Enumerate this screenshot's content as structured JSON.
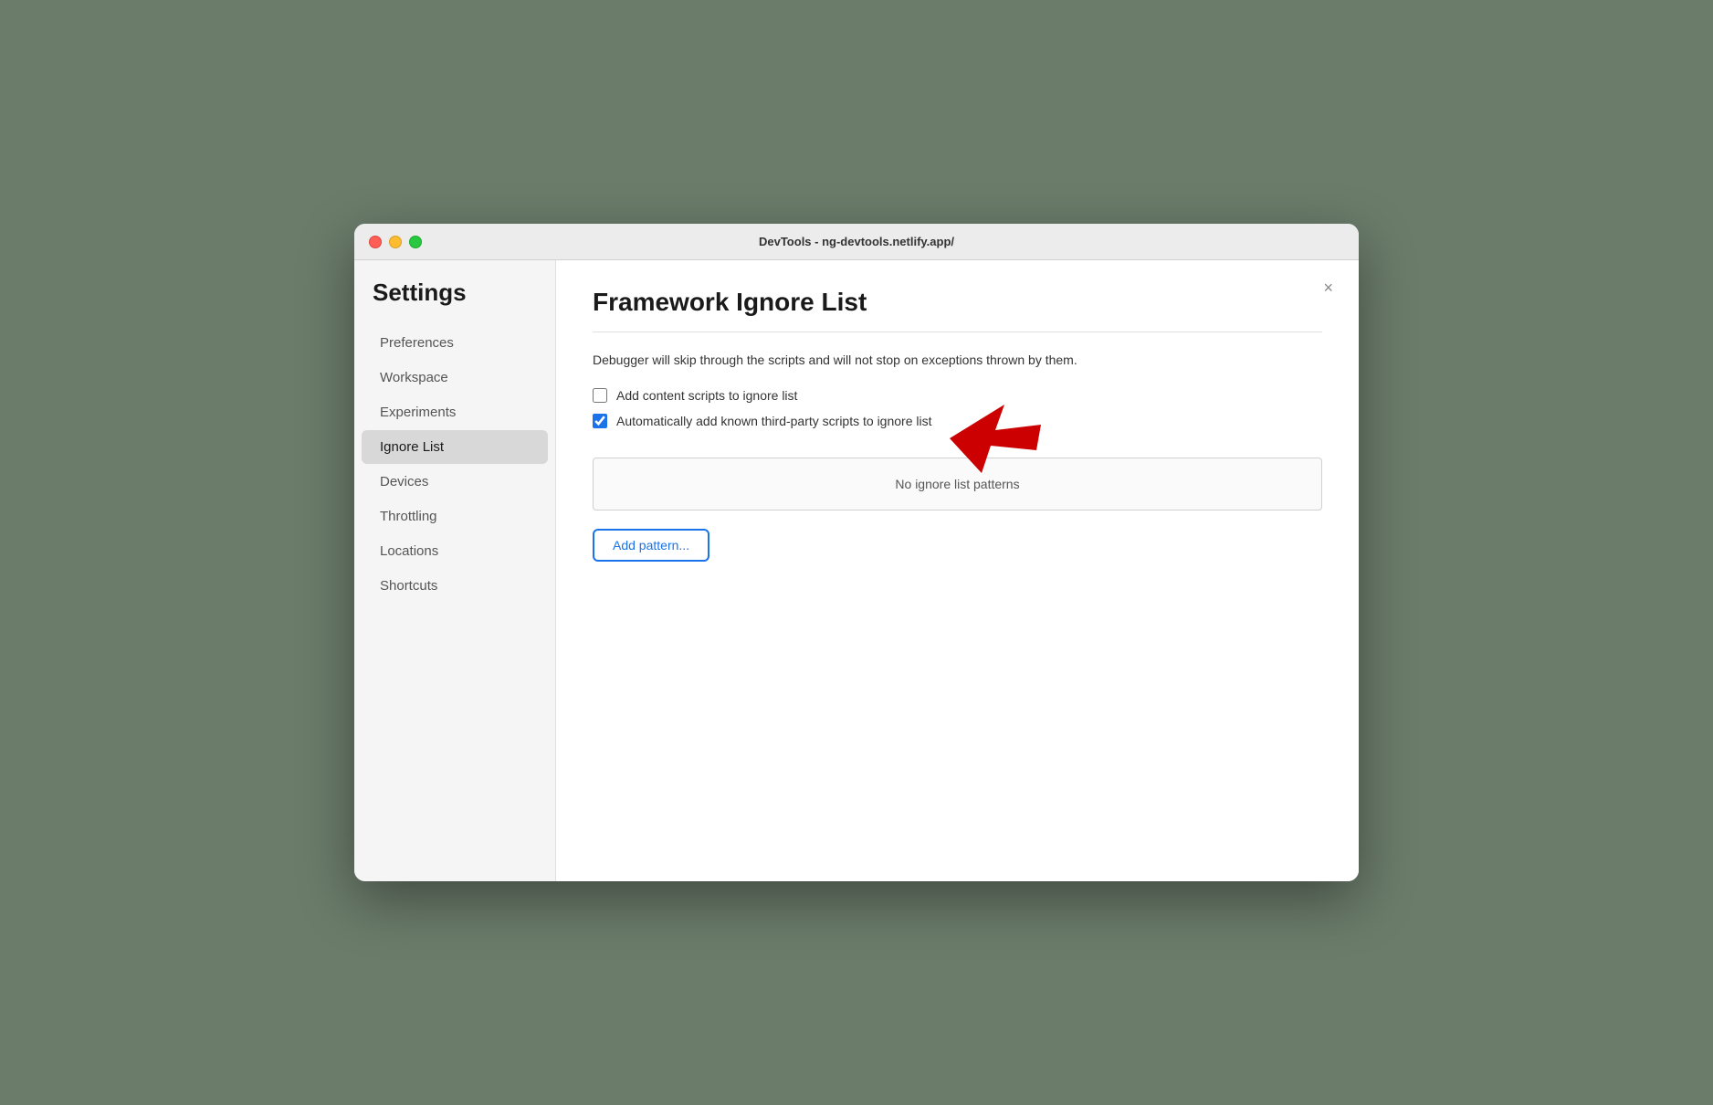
{
  "window": {
    "title": "DevTools - ng-devtools.netlify.app/"
  },
  "sidebar": {
    "heading": "Settings",
    "items": [
      {
        "id": "preferences",
        "label": "Preferences",
        "active": false
      },
      {
        "id": "workspace",
        "label": "Workspace",
        "active": false
      },
      {
        "id": "experiments",
        "label": "Experiments",
        "active": false
      },
      {
        "id": "ignore-list",
        "label": "Ignore List",
        "active": true
      },
      {
        "id": "devices",
        "label": "Devices",
        "active": false
      },
      {
        "id": "throttling",
        "label": "Throttling",
        "active": false
      },
      {
        "id": "locations",
        "label": "Locations",
        "active": false
      },
      {
        "id": "shortcuts",
        "label": "Shortcuts",
        "active": false
      }
    ]
  },
  "main": {
    "title": "Framework Ignore List",
    "description": "Debugger will skip through the scripts and will not stop on exceptions thrown by them.",
    "checkboxes": [
      {
        "id": "add-content-scripts",
        "label": "Add content scripts to ignore list",
        "checked": false
      },
      {
        "id": "auto-add-third-party",
        "label": "Automatically add known third-party scripts to ignore list",
        "checked": true
      }
    ],
    "patterns_placeholder": "No ignore list patterns",
    "add_button_label": "Add pattern...",
    "close_label": "×"
  }
}
